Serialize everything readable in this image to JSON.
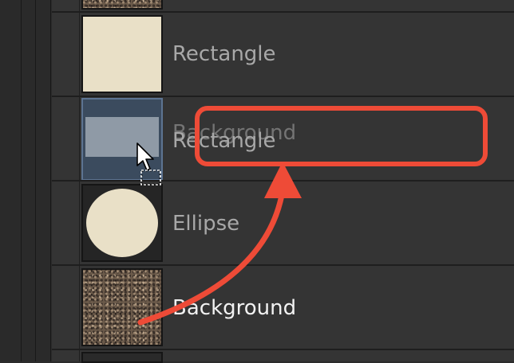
{
  "layers": [
    {
      "label": "Rectangle",
      "thumbnail": "cream-rectangle"
    },
    {
      "label": "Rectangle",
      "thumbnail": "dragged-layer",
      "ghost_label": "Background"
    },
    {
      "label": "Ellipse",
      "thumbnail": "cream-ellipse"
    },
    {
      "label": "Background",
      "thumbnail": "gravel-texture"
    }
  ],
  "colors": {
    "panel_bg": "#343434",
    "cream": "#e9e0c7",
    "annotation": "#ee4b37",
    "selection": "#5d7492"
  }
}
